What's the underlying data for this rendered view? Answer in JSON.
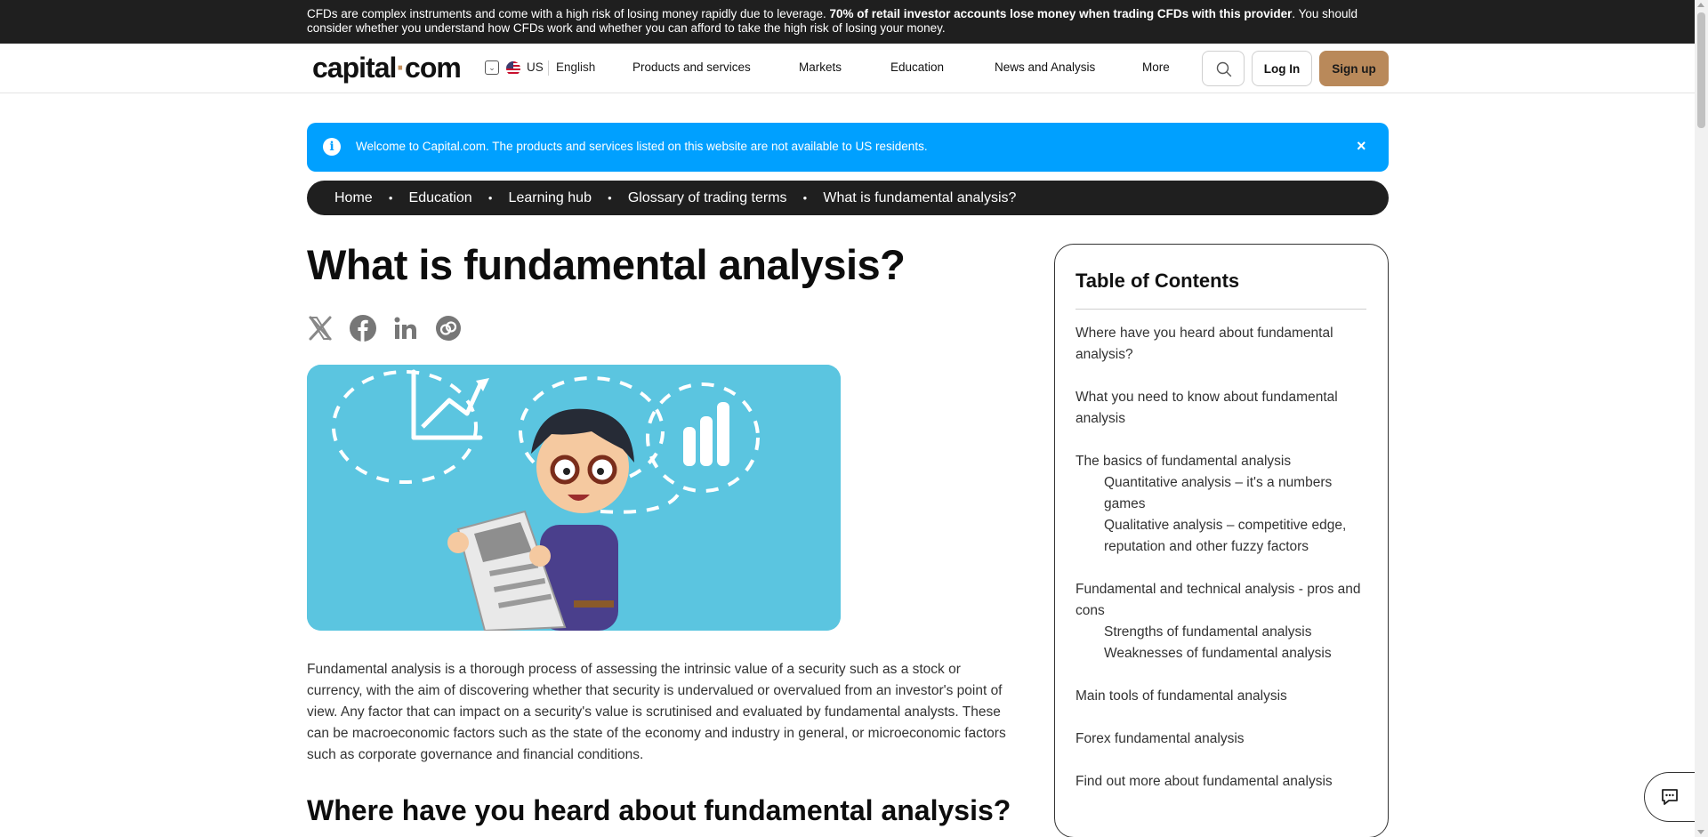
{
  "risk_warning": {
    "text_before": "CFDs are complex instruments and come with a high risk of losing money rapidly due to leverage. ",
    "bold": "70% of retail investor accounts lose money when trading CFDs with this provider",
    "text_after": ". You should consider whether you understand how CFDs work and whether you can afford to take the high risk of losing your money."
  },
  "header": {
    "logo_left": "capital",
    "logo_dot": "·",
    "logo_right": "com",
    "country": "US",
    "language": "English",
    "nav": [
      "Products and services",
      "Markets",
      "Education",
      "News and Analysis",
      "More"
    ],
    "login_label": "Log In",
    "signup_label": "Sign up"
  },
  "info_banner": {
    "icon": "i",
    "text": "Welcome to Capital.com. The products and services listed on this website are not available to US residents.",
    "close": "×"
  },
  "breadcrumb": [
    "Home",
    "Education",
    "Learning hub",
    "Glossary of trading terms",
    "What is fundamental analysis?"
  ],
  "article": {
    "title": "What is fundamental analysis?",
    "share_icons": [
      "x-icon",
      "facebook-icon",
      "linkedin-icon",
      "copy-link-icon"
    ],
    "lead": "Fundamental analysis is a thorough process of assessing the intrinsic value of a security such as a stock or currency, with the aim of discovering whether that security is undervalued or overvalued from an investor's point of view. Any factor that can impact on a security's value is scrutinised and evaluated by fundamental analysts. These can be macroeconomic factors such as the state of the economy and industry in general, or microeconomic factors such as corporate governance and financial conditions.",
    "heading2": "Where have you heard about fundamental analysis?"
  },
  "toc": {
    "title": "Table of Contents",
    "items": [
      {
        "label": "Where have you heard about fundamental analysis?",
        "subs": []
      },
      {
        "label": "What you need to know about fundamental analysis",
        "subs": []
      },
      {
        "label": "The basics of fundamental analysis",
        "subs": [
          "Quantitative analysis – it's a numbers games",
          "Qualitative analysis – competitive edge, reputation and other fuzzy factors"
        ]
      },
      {
        "label": "Fundamental and technical analysis - pros and cons",
        "subs": [
          "Strengths of fundamental analysis",
          "Weaknesses of fundamental analysis"
        ]
      },
      {
        "label": "Main tools of fundamental analysis",
        "subs": []
      },
      {
        "label": "Forex fundamental analysis",
        "subs": []
      },
      {
        "label": "Find out more about fundamental analysis",
        "subs": []
      }
    ]
  },
  "colors": {
    "accent": "#b9895a",
    "info_blue": "#00a0ff",
    "dark": "#1f1f1f"
  }
}
